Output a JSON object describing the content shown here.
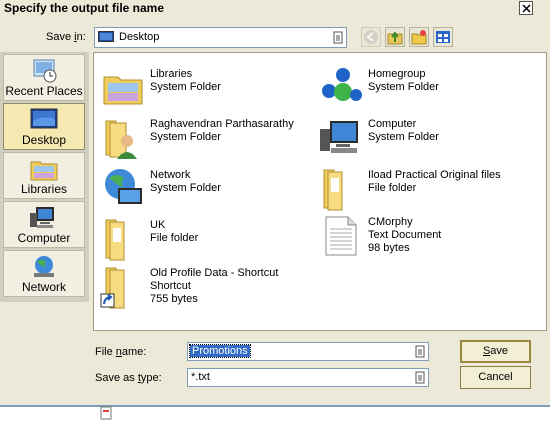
{
  "dialog": {
    "title": "Specify the output file name"
  },
  "save_in": {
    "label": "Save in:",
    "value": "Desktop"
  },
  "places_bar": [
    {
      "label": "Recent Places",
      "icon": "recent-places-icon",
      "active": false
    },
    {
      "label": "Desktop",
      "icon": "desktop-icon",
      "active": true
    },
    {
      "label": "Libraries",
      "icon": "libraries-icon",
      "active": false
    },
    {
      "label": "Computer",
      "icon": "computer-icon",
      "active": false
    },
    {
      "label": "Network",
      "icon": "network-icon",
      "active": false
    }
  ],
  "files": [
    {
      "name": "Libraries",
      "type": "System Folder",
      "icon": "libraries-folder-icon"
    },
    {
      "name": "Homegroup",
      "type": "System Folder",
      "icon": "homegroup-icon"
    },
    {
      "name": "Raghavendran Parthasarathy",
      "type": "System Folder",
      "icon": "user-folder-icon"
    },
    {
      "name": "Computer",
      "type": "System Folder",
      "icon": "computer-icon"
    },
    {
      "name": "Network",
      "type": "System Folder",
      "icon": "network-icon"
    },
    {
      "name": "Iload Practical Original files",
      "type": "File folder",
      "icon": "folder-icon"
    },
    {
      "name": "UK",
      "type": "File folder",
      "icon": "folder-icon"
    },
    {
      "name": "CMorphy",
      "type": "Text Document",
      "size": "98 bytes",
      "icon": "text-document-icon"
    },
    {
      "name": "Old Profile Data - Shortcut",
      "type": "Shortcut",
      "size": "755 bytes",
      "icon": "shortcut-folder-icon"
    }
  ],
  "file_name": {
    "label": "File name:",
    "value": "Promotions"
  },
  "save_as_type": {
    "label": "Save as type:",
    "value": "*.txt"
  },
  "buttons": {
    "save": "Save",
    "cancel": "Cancel"
  },
  "colors": {
    "dialog_bg": "#ece9d8",
    "selection": "#316ac5",
    "input_border": "#7f9db9",
    "active_place": "#f4e9b0"
  }
}
